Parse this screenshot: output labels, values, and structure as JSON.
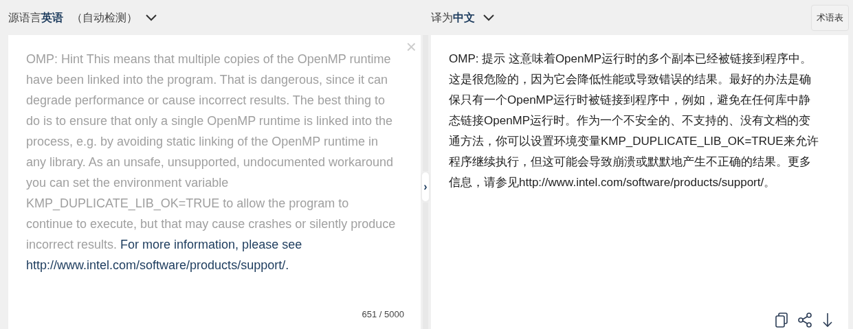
{
  "source_language": {
    "prefix": "源语言",
    "language": "英语",
    "detect": "（自动检测）"
  },
  "target_language": {
    "prefix": "译为",
    "language": "中文"
  },
  "glossary_button": "术语表",
  "source": {
    "text": "OMP: Hint This means that multiple copies of the OpenMP runtime have been linked into the program. That is dangerous, since it can degrade performance or cause incorrect results. The best thing to do is to ensure that only a single OpenMP runtime is linked into the process, e.g. by avoiding static linking of the OpenMP runtime in any library. As an unsafe, unsupported, undocumented workaround you can set the environment variable KMP_DUPLICATE_LIB_OK=TRUE to allow the program to continue to execute, but that may cause crashes or silently produce incorrect results.",
    "highlighted_text": "For more information, please see http://www.intel.com/software/products/support/.",
    "clear": "×",
    "counter": "651 / 5000"
  },
  "toggle": "›",
  "translation": {
    "text": "OMP: 提示 这意味着OpenMP运行时的多个副本已经被链接到程序中。这是很危险的，因为它会降低性能或导致错误的结果。最好的办法是确保只有一个OpenMP运行时被链接到程序中，例如，避免在任何库中静态链接OpenMP运行时。作为一个不安全的、不支持的、没有文档的变通方法，你可以设置环境变量KMP_DUPLICATE_LIB_OK=TRUE来允许程序继续执行，但这可能会导致崩溃或默默地产生不正确的结果。更多信息，请参见http://www.intel.com/software/products/support/。"
  }
}
